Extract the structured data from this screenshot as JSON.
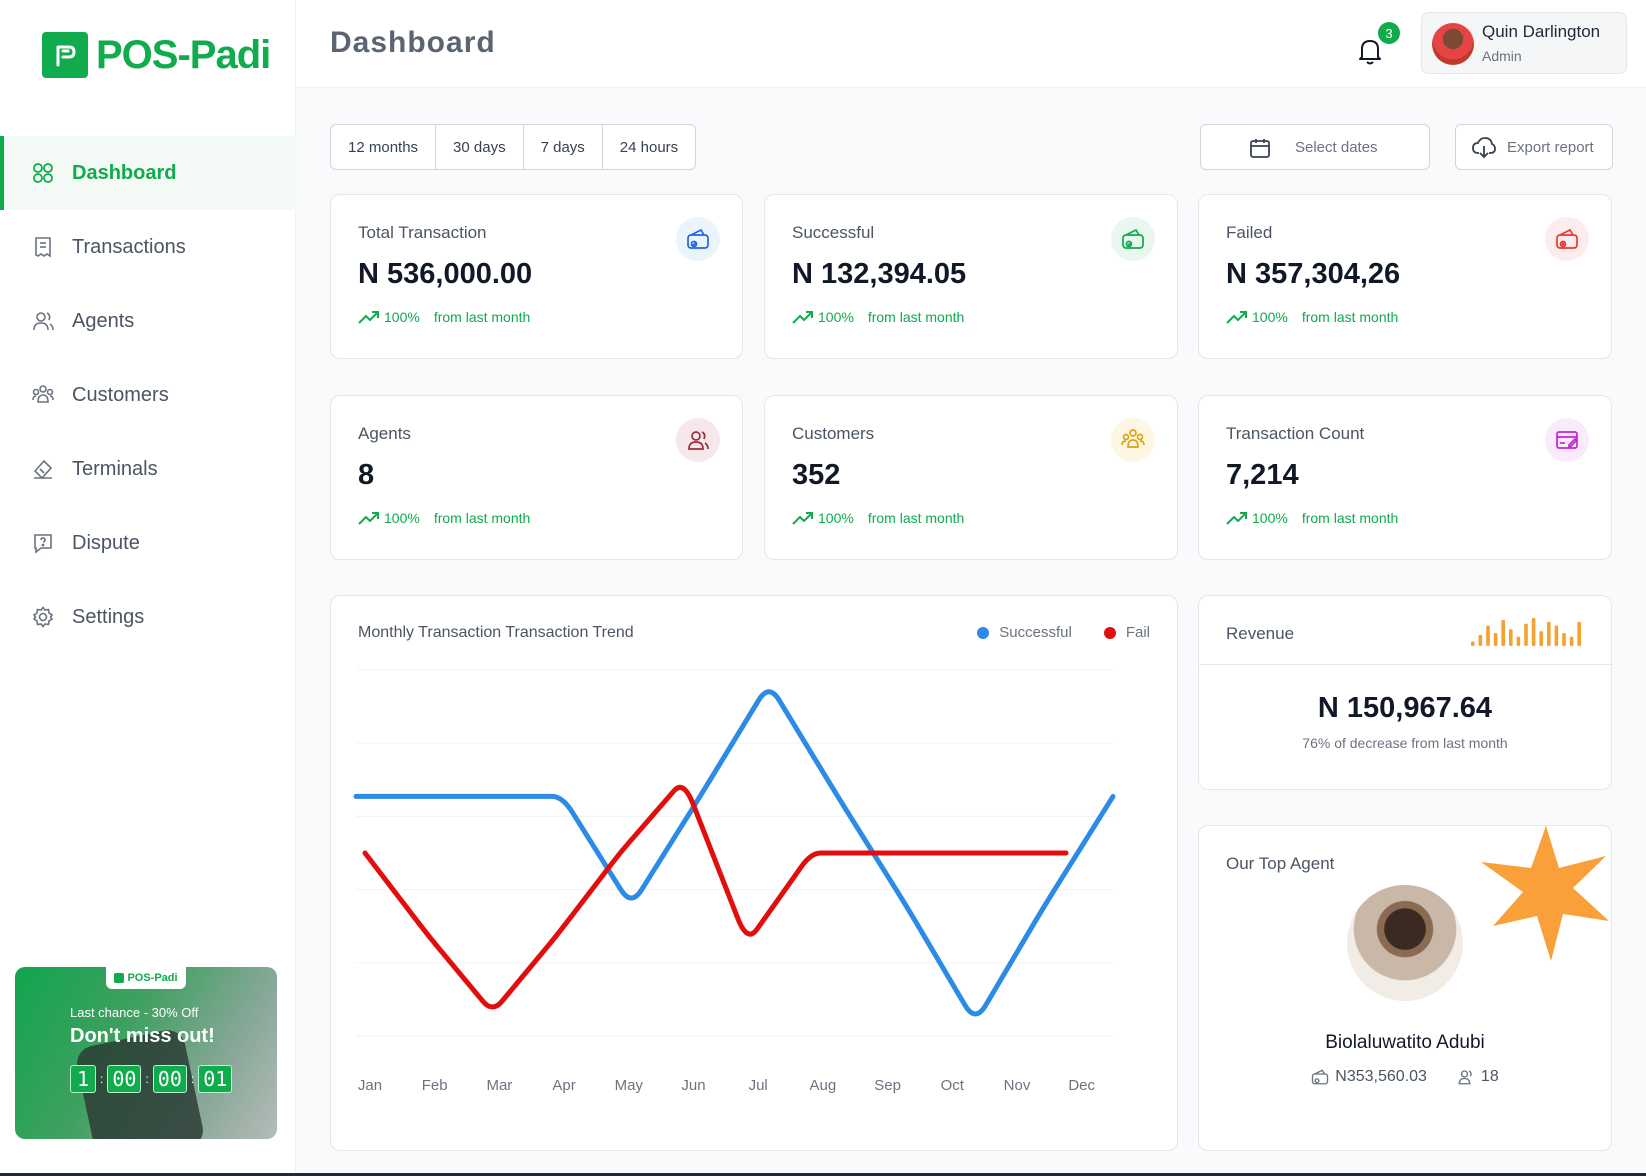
{
  "brand": {
    "name": "POS-Padi",
    "color": "#0fab4d"
  },
  "sidebar": {
    "items": [
      {
        "label": "Dashboard",
        "icon": "grid-icon",
        "active": true
      },
      {
        "label": "Transactions",
        "icon": "receipt-icon"
      },
      {
        "label": "Agents",
        "icon": "users-icon"
      },
      {
        "label": "Customers",
        "icon": "user-group-icon"
      },
      {
        "label": "Terminals",
        "icon": "terminal-icon"
      },
      {
        "label": "Dispute",
        "icon": "chat-question-icon"
      },
      {
        "label": "Settings",
        "icon": "gear-icon"
      }
    ],
    "promo": {
      "badge": "POS-Padi",
      "subtitle": "Last chance - 30% Off",
      "title": "Don't miss out!",
      "countdown": [
        "1",
        "00",
        "00",
        "01"
      ]
    }
  },
  "header": {
    "title": "Dashboard",
    "notifications": "3",
    "user": {
      "name": "Quin Darlington",
      "role": "Admin"
    }
  },
  "filters": {
    "ranges": [
      "12 months",
      "30 days",
      "7 days",
      "24 hours"
    ],
    "select_dates": "Select dates",
    "export": "Export report"
  },
  "stats": [
    {
      "label": "Total Transaction",
      "value": "N 536,000.00",
      "pct": "100%",
      "note": "from last month",
      "icon": "wallet-icon",
      "icon_color": "#2563eb",
      "icon_bg": "#eaf4fd"
    },
    {
      "label": "Successful",
      "value": "N 132,394.05",
      "pct": "100%",
      "note": "from last month",
      "icon": "wallet-check-icon",
      "icon_color": "#0fab4d",
      "icon_bg": "#eaf7ef"
    },
    {
      "label": "Failed",
      "value": "N 357,304,26",
      "pct": "100%",
      "note": "from last month",
      "icon": "wallet-x-icon",
      "icon_color": "#e53935",
      "icon_bg": "#fdecec"
    },
    {
      "label": "Agents",
      "value": "8",
      "pct": "100%",
      "note": "from last month",
      "icon": "users-icon",
      "icon_color": "#9b2c3a",
      "icon_bg": "#f6e8ea"
    },
    {
      "label": "Customers",
      "value": "352",
      "pct": "100%",
      "note": "from last month",
      "icon": "user-group-icon",
      "icon_color": "#e0a31a",
      "icon_bg": "#fdf6e3"
    },
    {
      "label": "Transaction Count",
      "value": "7,214",
      "pct": "100%",
      "note": "from last month",
      "icon": "card-edit-icon",
      "icon_color": "#c026d3",
      "icon_bg": "#fbeafd"
    }
  ],
  "chart": {
    "title": "Monthly Transaction Transaction Trend",
    "legend": [
      {
        "name": "Successful",
        "color": "#2b8be5"
      },
      {
        "name": "Fail",
        "color": "#e20e0e"
      }
    ]
  },
  "chart_data": {
    "type": "line",
    "title": "Monthly Transaction Transaction Trend",
    "x": [
      "Jan",
      "Feb",
      "Mar",
      "Apr",
      "May",
      "Jun",
      "Jul",
      "Aug",
      "Sep",
      "Oct",
      "Nov",
      "Dec"
    ],
    "series": [
      {
        "name": "Successful",
        "color": "#2b8be5",
        "values": [
          72,
          72,
          72,
          72,
          39,
          72,
          106,
          72,
          39,
          4,
          39,
          72
        ]
      },
      {
        "name": "Fail",
        "color": "#e20e0e",
        "values": [
          55,
          30,
          7,
          30,
          55,
          77,
          28,
          55,
          55,
          55,
          55,
          55
        ]
      }
    ],
    "ylim": [
      0,
      110
    ],
    "grid": true,
    "legend_position": "top-right"
  },
  "revenue": {
    "title": "Revenue",
    "value": "N 150,967.64",
    "note": "76% of decrease from last month",
    "bars": [
      5,
      12,
      22,
      14,
      28,
      18,
      10,
      24,
      30,
      16,
      26,
      22,
      14,
      10,
      26
    ]
  },
  "top_agent": {
    "title": "Our Top Agent",
    "name": "Biolaluwatito Adubi",
    "amount": "N353,560.03",
    "count": "18"
  }
}
